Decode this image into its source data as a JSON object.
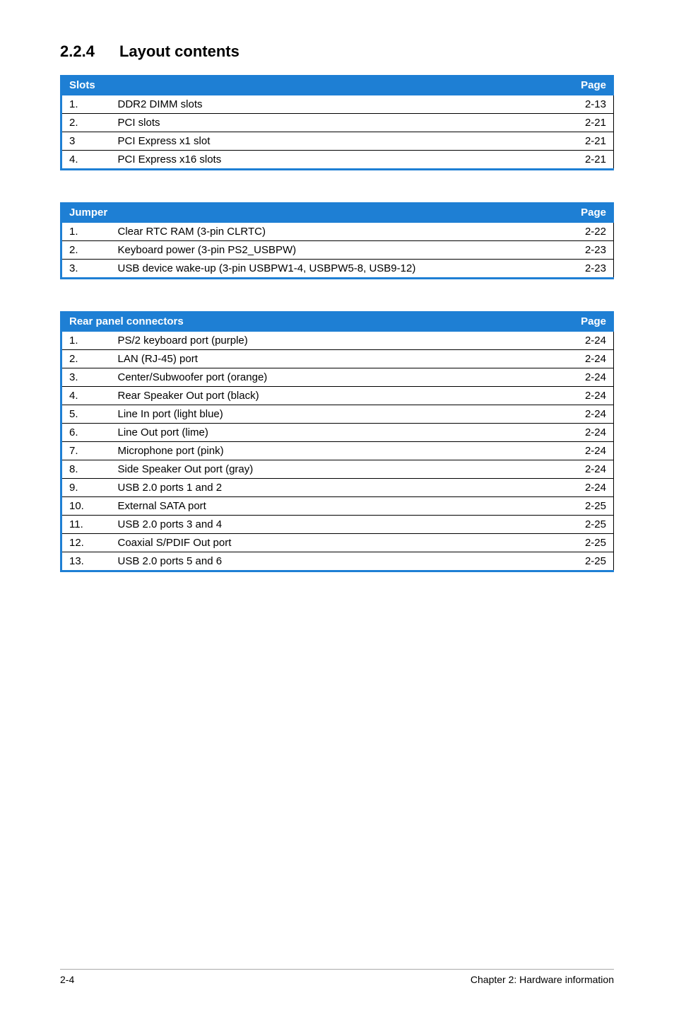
{
  "heading": {
    "number": "2.2.4",
    "title": "Layout contents"
  },
  "tables": {
    "slots": {
      "header_left": "Slots",
      "header_right": "Page",
      "rows": [
        {
          "n": "1.",
          "desc": "DDR2 DIMM slots",
          "page": "2-13"
        },
        {
          "n": "2.",
          "desc": "PCI slots",
          "page": "2-21"
        },
        {
          "n": "3",
          "desc": "PCI Express x1 slot",
          "page": "2-21"
        },
        {
          "n": "4.",
          "desc": "PCI Express x16 slots",
          "page": "2-21"
        }
      ]
    },
    "jumper": {
      "header_left": "Jumper",
      "header_right": "Page",
      "rows": [
        {
          "n": "1.",
          "desc": "Clear RTC RAM (3-pin CLRTC)",
          "page": "2-22"
        },
        {
          "n": "2.",
          "desc": "Keyboard power (3-pin PS2_USBPW)",
          "page": "2-23"
        },
        {
          "n": "3.",
          "desc": "USB device wake-up (3-pin USBPW1-4, USBPW5-8, USB9-12)",
          "page": "2-23"
        }
      ]
    },
    "rear": {
      "header_left": "Rear panel connectors",
      "header_right": "Page",
      "rows": [
        {
          "n": "1.",
          "desc": "PS/2 keyboard port (purple)",
          "page": "2-24"
        },
        {
          "n": "2.",
          "desc": "LAN (RJ-45) port",
          "page": "2-24"
        },
        {
          "n": "3.",
          "desc": "Center/Subwoofer port (orange)",
          "page": "2-24"
        },
        {
          "n": "4.",
          "desc": "Rear Speaker Out port (black)",
          "page": "2-24"
        },
        {
          "n": "5.",
          "desc": "Line In port (light blue)",
          "page": "2-24"
        },
        {
          "n": "6.",
          "desc": "Line Out port (lime)",
          "page": "2-24"
        },
        {
          "n": "7.",
          "desc": "Microphone port (pink)",
          "page": "2-24"
        },
        {
          "n": "8.",
          "desc": "Side Speaker Out port (gray)",
          "page": "2-24"
        },
        {
          "n": "9.",
          "desc": "USB 2.0 ports 1 and 2",
          "page": "2-24"
        },
        {
          "n": "10.",
          "desc": "External SATA port",
          "page": "2-25"
        },
        {
          "n": "11.",
          "desc": "USB 2.0 ports 3 and 4",
          "page": "2-25"
        },
        {
          "n": "12.",
          "desc": "Coaxial S/PDIF Out port",
          "page": "2-25"
        },
        {
          "n": "13.",
          "desc": "USB 2.0 ports 5 and 6",
          "page": "2-25"
        }
      ]
    }
  },
  "footer": {
    "left": "2-4",
    "right": "Chapter 2: Hardware information"
  }
}
